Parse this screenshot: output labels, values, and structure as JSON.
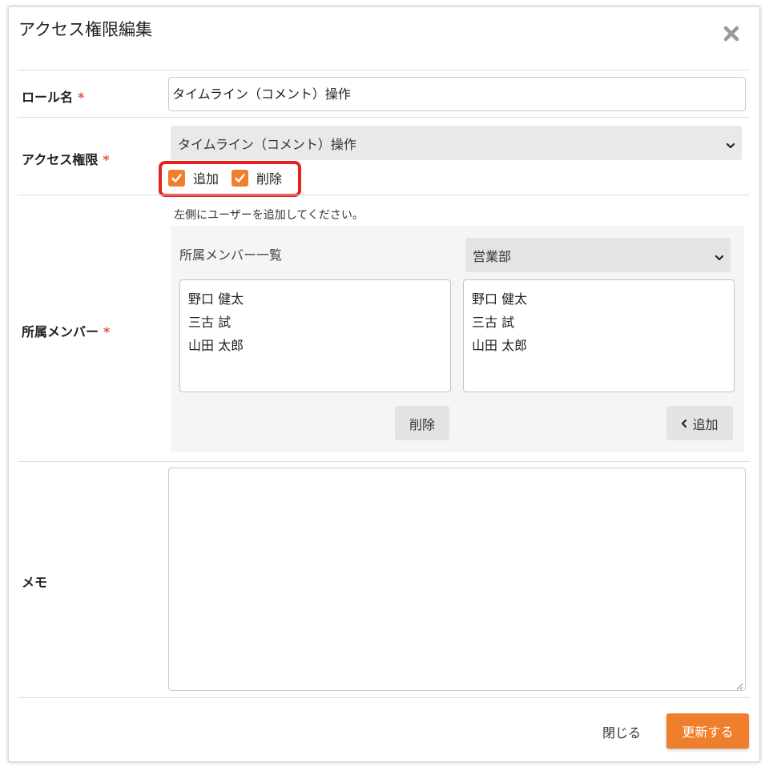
{
  "modal": {
    "title": "アクセス権限編集",
    "close_icon": "close-icon"
  },
  "form": {
    "role_name": {
      "label": "ロール名",
      "required": "*",
      "value": "タイムライン（コメント）操作"
    },
    "access": {
      "label": "アクセス権限",
      "required": "*",
      "selected": "タイムライン（コメント）操作",
      "checkboxes": [
        {
          "label": "追加",
          "checked": true
        },
        {
          "label": "削除",
          "checked": true
        }
      ]
    },
    "members": {
      "label": "所属メンバー",
      "required": "*",
      "hint": "左側にユーザーを追加してください。",
      "panel_title": "所属メンバー一覧",
      "department_selected": "営業部",
      "assigned": [
        "野口 健太",
        "三古 試",
        "山田 太郎"
      ],
      "available": [
        "野口 健太",
        "三古 試",
        "山田 太郎"
      ],
      "remove_label": "削除",
      "add_label": "追加"
    },
    "memo": {
      "label": "メモ",
      "value": ""
    }
  },
  "footer": {
    "close_label": "閉じる",
    "update_label": "更新する"
  },
  "colors": {
    "accent": "#ef7f2c",
    "required": "#e0573c",
    "highlight": "#e8211c"
  }
}
